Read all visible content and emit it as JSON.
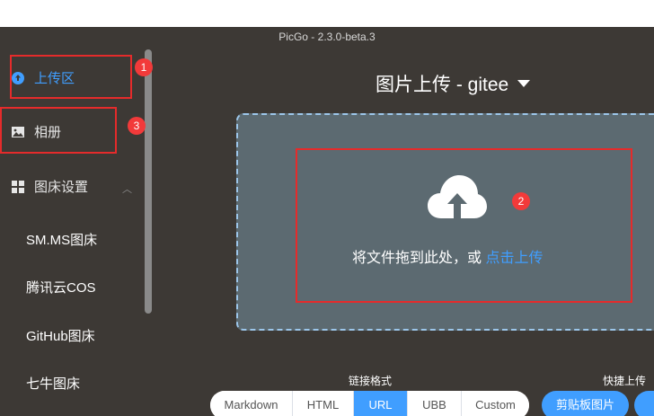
{
  "window": {
    "title": "PicGo - 2.3.0-beta.3"
  },
  "sidebar": {
    "items": [
      {
        "label": "上传区",
        "icon": "cloud-upload-icon",
        "active": true
      },
      {
        "label": "相册",
        "icon": "image-icon"
      },
      {
        "label": "图床设置",
        "icon": "grid-icon",
        "expanded": true
      }
    ],
    "subitems": [
      "SM.MS图床",
      "腾讯云COS",
      "GitHub图床",
      "七牛图床"
    ]
  },
  "main": {
    "title": "图片上传 - gitee",
    "drop_text": "将文件拖到此处，或 ",
    "drop_link": "点击上传"
  },
  "format": {
    "label": "链接格式",
    "options": [
      "Markdown",
      "HTML",
      "URL",
      "UBB",
      "Custom"
    ],
    "selected": "URL"
  },
  "quick": {
    "label": "快捷上传",
    "clipboard_button": "剪贴板图片"
  },
  "annotations": [
    "1",
    "2",
    "3"
  ],
  "colors": {
    "accent": "#409eff",
    "background": "#3d3935",
    "dropzone": "#5c6a71",
    "annotation": "#e52b2b"
  }
}
